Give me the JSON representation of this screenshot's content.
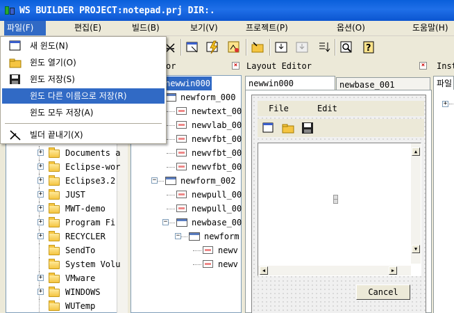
{
  "window": {
    "title": "WS BUILDER PROJECT:notepad.prj DIR:."
  },
  "menubar": [
    "파일(F)",
    "편집(E)",
    "빌드(B)",
    "보기(V)",
    "프로젝트(P)",
    "옵션(O)",
    "도움말(H)"
  ],
  "file_menu": {
    "items": [
      {
        "label": "새 윈도(N)",
        "icon": "new-window-icon"
      },
      {
        "label": "윈도 열기(O)",
        "icon": "open-folder-icon"
      },
      {
        "label": "윈도 저장(S)",
        "icon": "floppy-save-icon"
      },
      {
        "label": "윈도 다른 이름으로 저장(R)",
        "icon": "",
        "highlighted": true
      },
      {
        "label": "윈도 모두 저장(A)",
        "icon": ""
      },
      {
        "label": "빌더 끝내기(X)",
        "icon": "exit-scissors-icon"
      }
    ]
  },
  "toolbar": {
    "icons": [
      "cut-icon",
      "form-select-icon",
      "lightning-icon",
      "build-icon",
      "folder-arrow-icon",
      "download-icon",
      "disabled-download-icon",
      "list-down-icon",
      "preview-icon",
      "help-icon"
    ]
  },
  "left_tree": {
    "items": [
      "Documents a",
      "Eclipse-wor",
      "Eclipse3.2",
      "JUST",
      "MWT-demo",
      "Program Fi",
      "RECYCLER",
      "SendTo",
      "System Volu",
      "VMware",
      "WINDOWS",
      "WUTemp"
    ]
  },
  "object_panel": {
    "title": "or",
    "items": [
      "newwin000",
      "newform_000",
      "newtext_00",
      "newvlab_00",
      "newvfbt_00",
      "newvfbt_00",
      "newvfbt_00",
      "newform_002",
      "newpull_00",
      "newpull_00",
      "newbase_00",
      "newform",
      "newv",
      "newv"
    ]
  },
  "layout_editor": {
    "title": "Layout Editor",
    "tabs": [
      "newwin000",
      "newbase_001"
    ],
    "form_menu": [
      "File",
      "Edit"
    ],
    "cancel_label": "Cancel"
  },
  "inspector": {
    "title": "Inst",
    "tab": "파일"
  },
  "colors": {
    "titlebar": "#0A5FDA",
    "highlight": "#316AC5",
    "face": "#ECE9D8"
  }
}
